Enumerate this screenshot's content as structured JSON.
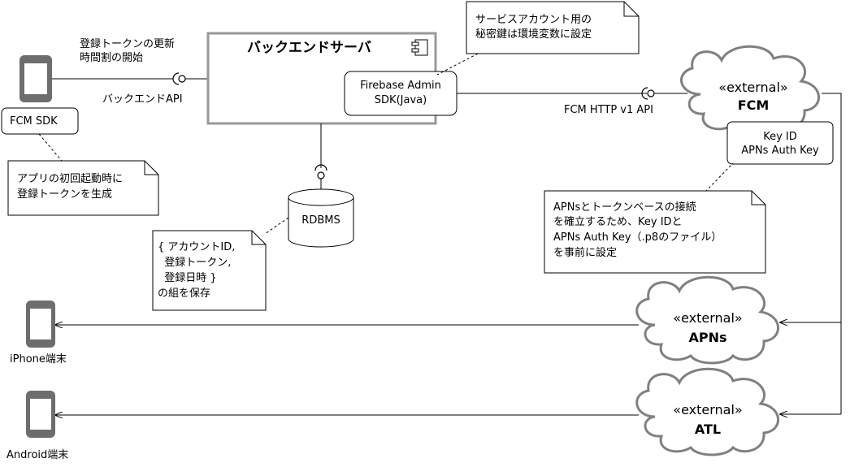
{
  "backend": {
    "title": "バックエンドサーバ",
    "lib_line1": "Firebase Admin",
    "lib_line2": "SDK(Java)"
  },
  "register_label": {
    "line1": "登録トークンの更新",
    "line2": "時間割の開始"
  },
  "backend_api_label": "バックエンドAPI",
  "fcm_sdk_label": "FCM SDK",
  "note_app": {
    "line1": "アプリの初回起動時に",
    "line2": "登録トークンを生成"
  },
  "note_service_account": {
    "line1": "サービスアカウント用の",
    "line2": "秘密鍵は環境変数に設定"
  },
  "fcm_http_label": "FCM HTTP v1 API",
  "fcm": {
    "stereotype": "«external»",
    "name": "FCM"
  },
  "key_box": {
    "line1": "Key ID",
    "line2": "APNs Auth Key"
  },
  "note_apns": {
    "line1": "APNsとトークンベースの接続",
    "line2": "を確立するため、Key IDと",
    "line3": "APNs Auth Key（.p8のファイル）",
    "line4": "を事前に設定"
  },
  "rdbms_label": "RDBMS",
  "note_db": {
    "line1": "{ アカウントID,",
    "line2": "  登録トークン,",
    "line3": "  登録日時 }",
    "line4": "の組を保存"
  },
  "apns": {
    "stereotype": "«external»",
    "name": "APNs"
  },
  "atl": {
    "stereotype": "«external»",
    "name": "ATL"
  },
  "iphone_label": "iPhone端末",
  "android_label": "Android端末",
  "colors": {
    "cloud_stroke": "#808080",
    "box_stroke": "#000000",
    "note_fill": "#ffffff"
  }
}
